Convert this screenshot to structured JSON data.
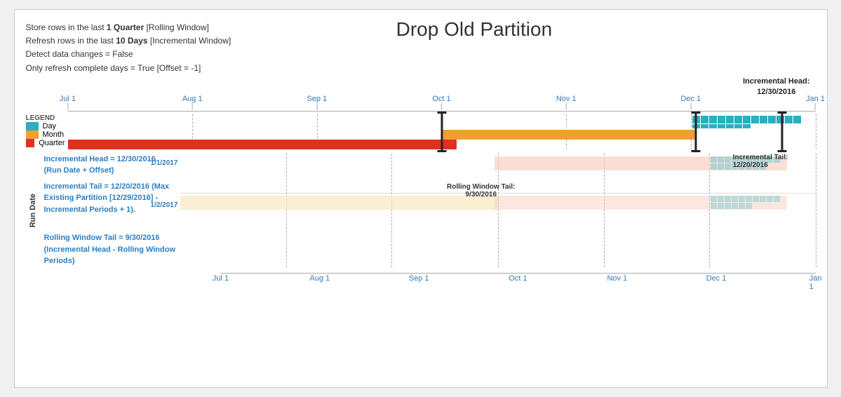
{
  "title": "Drop Old Partition",
  "headerInfo": {
    "line1": {
      "prefix": "Store rows in the last ",
      "bold1": "1 Quarter",
      "suffix1": " [Rolling Window]"
    },
    "line2": {
      "prefix": "Refresh rows in the last ",
      "bold2": "10 Days",
      "suffix2": " [Incremental Window]"
    },
    "line3": "Detect data changes = False",
    "line4": "Only refresh complete days = True [Offset = -1]"
  },
  "legend": {
    "title": "LEGEND",
    "items": [
      {
        "label": "Day",
        "color": "#2ab0c0"
      },
      {
        "label": "Month",
        "color": "#f0a030"
      },
      {
        "label": "Quarter",
        "color": "#e03020"
      }
    ]
  },
  "axisLabels": [
    "Jul 1",
    "Aug 1",
    "Sep 1",
    "Oct 1",
    "Nov 1",
    "Dec 1",
    "Jan 1"
  ],
  "axisPositions": [
    0,
    16.67,
    33.33,
    50,
    66.67,
    83.33,
    100
  ],
  "incrementalHeadLabel": "Incremental Head:\n12/30/2016",
  "incrementalHeadPos": 95.7,
  "rollingWindowTailLabel": "Rolling Window Tail:\n9/30/2016",
  "rollingWindowTailPos": 49,
  "incrementalTailLabel": "Incremental Tail:\n12/20/2016",
  "incrementalTailPos": 93,
  "annotations": {
    "runDateLabel": "Run Date",
    "rows": [
      {
        "dateLabel": "1/1/2017",
        "infoText": [
          {
            "text": "Incremental Head = 12/30/2016",
            "bold": true
          },
          {
            "text": "(Run Date + Offset)",
            "bold": false
          },
          {
            "text": "",
            "bold": false
          },
          {
            "text": "Incremental Tail = 12/20/2016 (Max",
            "bold": true
          },
          {
            "text": "Existing Partition [12/29/2016] -",
            "bold": false
          },
          {
            "text": "Incremental Periods + 1).",
            "bold": false
          }
        ]
      },
      {
        "dateLabel": "1/2/2017",
        "infoText": [
          {
            "text": "Rolling Window Tail = 9/30/2016",
            "bold": true
          },
          {
            "text": "(Incremental Head - Rolling Window",
            "bold": false
          },
          {
            "text": "Periods)",
            "bold": false
          }
        ]
      }
    ]
  },
  "colors": {
    "teal": "#2ab0c0",
    "orange": "#f0a030",
    "red": "#e03020",
    "tealLight": "#a0dde4",
    "orangeLight": "#f8d8a0",
    "markerBlack": "#222222",
    "axisBlue": "#337ab7"
  }
}
